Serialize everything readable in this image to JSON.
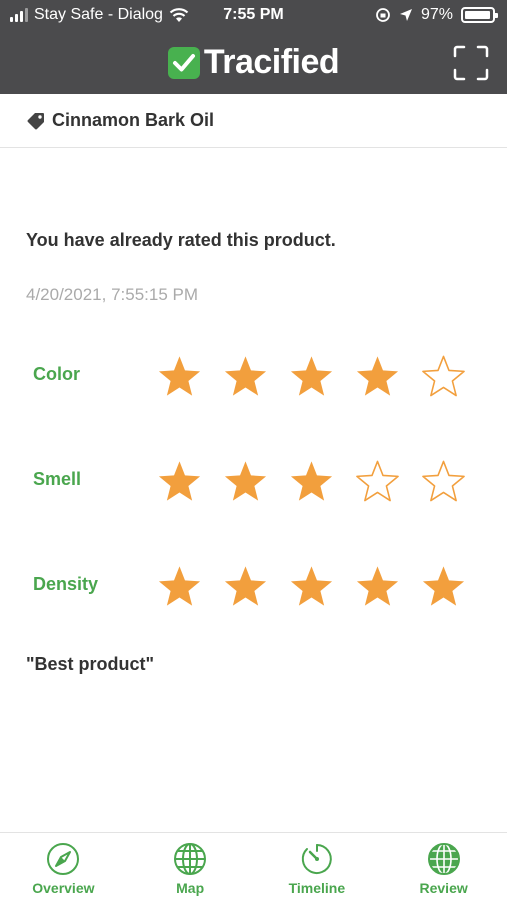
{
  "status_bar": {
    "carrier": "Stay Safe - Dialog",
    "time": "7:55 PM",
    "battery_percent": "97%",
    "battery_level": 0.97
  },
  "header": {
    "brand_name": "Tracified",
    "brand_color": "#48b14f",
    "header_color": "#4b4b4d"
  },
  "product": {
    "name": "Cinnamon Bark Oil",
    "icon": "tag-icon"
  },
  "review": {
    "message": "You have already rated this product.",
    "timestamp": "4/20/2021, 7:55:15 PM",
    "ratings": [
      {
        "label": "Color",
        "stars": 4,
        "max": 5
      },
      {
        "label": "Smell",
        "stars": 3,
        "max": 5
      },
      {
        "label": "Density",
        "stars": 5,
        "max": 5
      }
    ],
    "comment": "\"Best product\"",
    "star_color": "#f29f3d",
    "label_color": "#4aa64e"
  },
  "tabs": [
    {
      "label": "Overview",
      "icon": "compass-icon"
    },
    {
      "label": "Map",
      "icon": "globe-icon"
    },
    {
      "label": "Timeline",
      "icon": "stopwatch-icon"
    },
    {
      "label": "Review",
      "icon": "globe-filled-icon",
      "active": true
    }
  ]
}
